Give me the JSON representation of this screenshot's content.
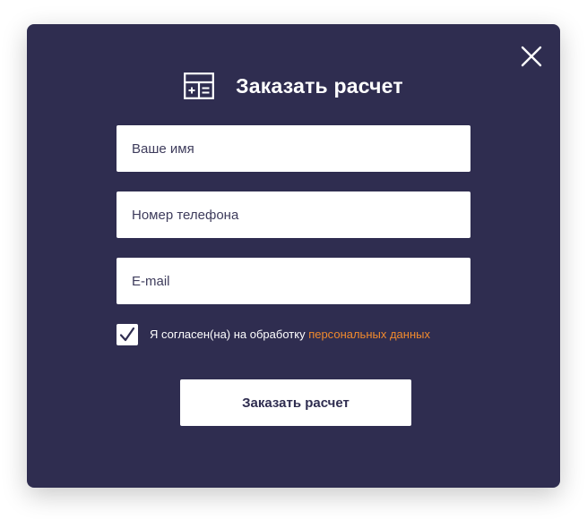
{
  "modal": {
    "title": "Заказать расчет",
    "title_icon": "calculator-icon",
    "close_icon": "close-icon"
  },
  "form": {
    "name_placeholder": "Ваше имя",
    "phone_placeholder": "Номер телефона",
    "email_placeholder": "E-mail",
    "consent": {
      "checked": true,
      "text": "Я согласен(на) на обработку",
      "link_text": "персональных данных"
    },
    "submit_label": "Заказать расчет"
  },
  "colors": {
    "modal_background": "#2f2d50",
    "accent_link": "#f18a2d",
    "field_background": "#ffffff",
    "text_light": "#ffffff"
  }
}
